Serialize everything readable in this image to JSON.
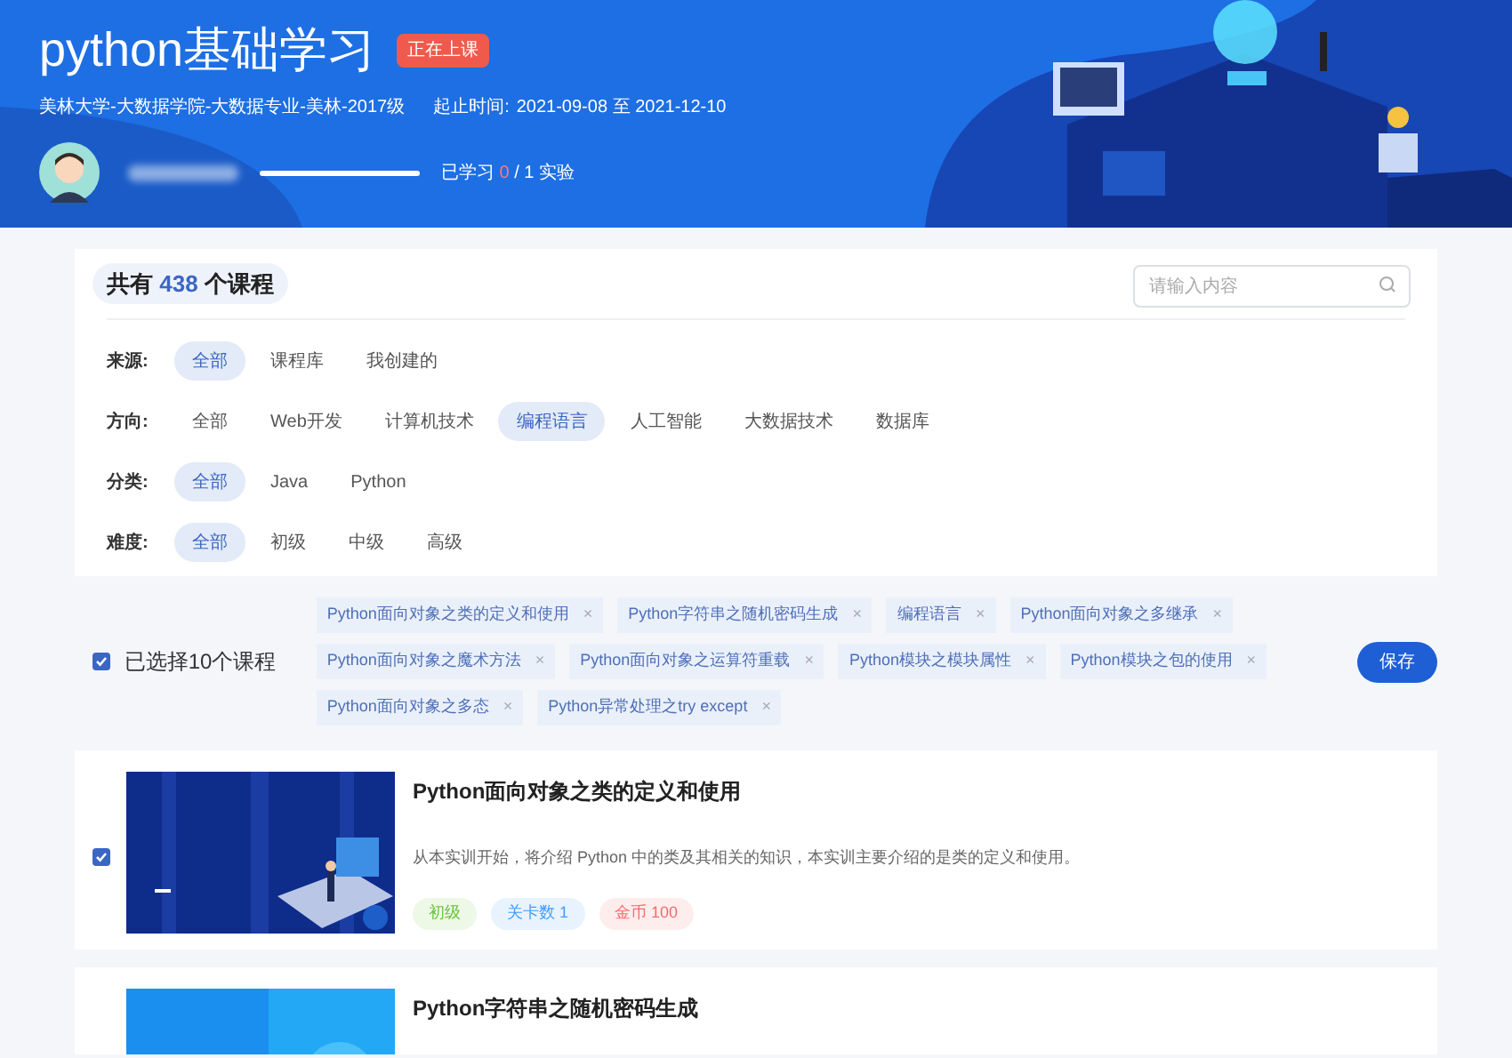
{
  "course": {
    "title": "python基础学习",
    "status_badge": "正在上课",
    "org": "美林大学-大数据学院-大数据专业-美林-2017级",
    "period_label": "起止时间:",
    "period": "2021-09-08 至 2021-12-10",
    "progress": {
      "prefix": "已学习",
      "done": "0",
      "rest": "/ 1 实验"
    }
  },
  "summary": {
    "prefix": "共有",
    "count": "438",
    "suffix": "个课程"
  },
  "search": {
    "placeholder": "请输入内容"
  },
  "filters": [
    {
      "label": "来源:",
      "options": [
        {
          "label": "全部",
          "selected": true
        },
        {
          "label": "课程库",
          "selected": false
        },
        {
          "label": "我创建的",
          "selected": false
        }
      ]
    },
    {
      "label": "方向:",
      "options": [
        {
          "label": "全部",
          "selected": false
        },
        {
          "label": "Web开发",
          "selected": false
        },
        {
          "label": "计算机技术",
          "selected": false
        },
        {
          "label": "编程语言",
          "selected": true
        },
        {
          "label": "人工智能",
          "selected": false
        },
        {
          "label": "大数据技术",
          "selected": false
        },
        {
          "label": "数据库",
          "selected": false
        }
      ]
    },
    {
      "label": "分类:",
      "options": [
        {
          "label": "全部",
          "selected": true
        },
        {
          "label": "Java",
          "selected": false
        },
        {
          "label": "Python",
          "selected": false
        }
      ]
    },
    {
      "label": "难度:",
      "options": [
        {
          "label": "全部",
          "selected": true
        },
        {
          "label": "初级",
          "selected": false
        },
        {
          "label": "中级",
          "selected": false
        },
        {
          "label": "高级",
          "selected": false
        }
      ]
    }
  ],
  "selection": {
    "checked": true,
    "label": "已选择10个课程",
    "save": "保存",
    "tags": [
      "Python面向对象之类的定义和使用",
      "Python字符串之随机密码生成",
      "编程语言",
      "Python面向对象之多继承",
      "Python面向对象之魔术方法",
      "Python面向对象之运算符重载",
      "Python模块之模块属性",
      "Python模块之包的使用",
      "Python面向对象之多态",
      "Python异常处理之try except"
    ],
    "remove": "×"
  },
  "courses": [
    {
      "checked": true,
      "title": "Python面向对象之类的定义和使用",
      "description": "从本实训开始，将介绍 Python 中的类及其相关的知识，本实训主要介绍的是类的定义和使用。",
      "tags": [
        {
          "label": "初级",
          "color": "#67c23a"
        },
        {
          "label": "关卡数 1",
          "color": "#409eff"
        },
        {
          "label": "金币 100",
          "color": "#f56c6c"
        }
      ]
    },
    {
      "title": "Python字符串之随机密码生成"
    }
  ]
}
